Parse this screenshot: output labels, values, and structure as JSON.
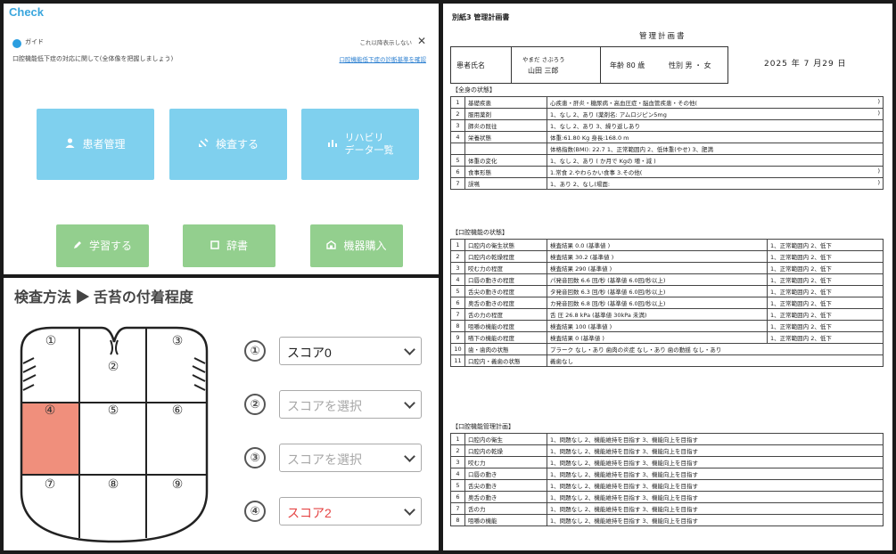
{
  "top_panel": {
    "title": "Check",
    "guide": {
      "label": "ガイド",
      "hide_text": "これ以降表示しない",
      "close_symbol": "✕",
      "text": "口腔機能低下症の対応に関して(全体像を把握しましょう)",
      "link": "口腔機能低下症の診断基準を確認"
    },
    "buttons": [
      {
        "label": "患者管理",
        "icon": "person-icon",
        "glyph": "👤"
      },
      {
        "label": "検査する",
        "icon": "clipboard-icon",
        "glyph": "✎"
      },
      {
        "label": "リハビリ\nデータ一覧",
        "icon": "chart-icon",
        "glyph": "▥"
      },
      {
        "label": "学習する",
        "icon": "pencil-icon",
        "glyph": "✎"
      },
      {
        "label": "辞書",
        "icon": "book-icon",
        "glyph": "▢"
      },
      {
        "label": "機器購入",
        "icon": "cart-icon",
        "glyph": "⌂"
      }
    ]
  },
  "exam_panel": {
    "title": "検査方法 ▶ 舌苔の付着程度",
    "tongue_regions": [
      "①",
      "②",
      "③",
      "④",
      "⑤",
      "⑥",
      "⑦",
      "⑧",
      "⑨"
    ],
    "scores": [
      {
        "num": "①",
        "value": "スコア0",
        "state": "selected"
      },
      {
        "num": "②",
        "value": "スコアを選択",
        "state": "placeholder"
      },
      {
        "num": "③",
        "value": "スコアを選択",
        "state": "placeholder"
      },
      {
        "num": "④",
        "value": "スコア2",
        "state": "highlight"
      }
    ],
    "highlight_color": "#f08f7c"
  },
  "document": {
    "label": "別紙3 管理計画書",
    "title": "管理計画書",
    "patient": {
      "name_label": "患者氏名",
      "kana": "やまだ さぶろう",
      "name": "山田 三郎",
      "age": "年齢 80 歳",
      "sex": "性別 男 ・ 女"
    },
    "date": "2025 年 7 月29 日",
    "sections": [
      {
        "heading": "【全身の状態】",
        "rows": [
          {
            "n": "1",
            "item": "基礎疾患",
            "content": "心疾患・肝炎・糖尿病・高血圧症・脳血管疾患・その他(",
            "right": ")"
          },
          {
            "n": "2",
            "item": "服用薬剤",
            "content": "1、なし 2、あり (薬剤名: アムロジピン5mg",
            "right": ")"
          },
          {
            "n": "3",
            "item": "肺炎の既往",
            "content": "1、なし 2、あり 3、繰り返しあり",
            "right": ""
          },
          {
            "n": "4",
            "item": "栄養状態",
            "content": "体重:61.80 Kg 身長:168.0 m",
            "right": ""
          },
          {
            "n": "",
            "item": "",
            "content": "体格指数(BMI): 22.7 1、正常範囲内 2、低体重(やせ) 3、肥満",
            "right": ""
          },
          {
            "n": "5",
            "item": "体重の変化",
            "content": "1、なし 2、あり ( か月で Kgの 増・減 )",
            "right": ""
          },
          {
            "n": "6",
            "item": "食事形態",
            "content": "1.常食 2.やわらかい食事 3.その他(",
            "right": ")"
          },
          {
            "n": "7",
            "item": "誤嚥",
            "content": "1、あり 2、なし(場面:",
            "right": ")"
          }
        ]
      },
      {
        "heading": "【口腔機能の状態】",
        "rows": [
          {
            "n": "1",
            "item": "口腔内の衛生状態",
            "res": "検査結果 0.0 (基準値 )",
            "right": "1、正常範囲内 2、低下"
          },
          {
            "n": "2",
            "item": "口腔内の乾燥程度",
            "res": "検査結果 30.2 (基準値 )",
            "right": "1、正常範囲内 2、低下"
          },
          {
            "n": "3",
            "item": "咬む力の程度",
            "res": "検査結果 290 (基準値 )",
            "right": "1、正常範囲内 2、低下"
          },
          {
            "n": "4",
            "item": "口唇の動きの程度",
            "res": "パ発音回数 6.6 回/秒 (基準値 6.0回/秒以上)",
            "right": "1、正常範囲内 2、低下"
          },
          {
            "n": "5",
            "item": "舌尖の動きの程度",
            "res": "タ発音回数 6.3 回/秒 (基準値 6.0回/秒以上)",
            "right": "1、正常範囲内 2、低下"
          },
          {
            "n": "6",
            "item": "奥舌の動きの程度",
            "res": "カ発音回数 6.8 回/秒 (基準値 6.0回/秒以上)",
            "right": "1、正常範囲内 2、低下"
          },
          {
            "n": "7",
            "item": "舌の力の程度",
            "res": "舌 圧 26.8 kPa (基準値 30kPa 未満)",
            "right": "1、正常範囲内 2、低下"
          },
          {
            "n": "8",
            "item": "咀嚼の機能の程度",
            "res": "検査結果 100 (基準値 )",
            "right": "1、正常範囲内 2、低下"
          },
          {
            "n": "9",
            "item": "嚥下の機能の程度",
            "res": "検査結果 0 (基準値 )",
            "right": "1、正常範囲内 2、低下"
          },
          {
            "n": "10",
            "item": "歯・歯肉の状態",
            "res": "プラーク なし・あり 歯肉の炎症 なし・あり 歯の動揺 なし・あり",
            "right": ""
          },
          {
            "n": "11",
            "item": "口腔内・義歯の状態",
            "res": "義歯なし",
            "right": ""
          }
        ]
      },
      {
        "heading": "【口腔機能管理計画】",
        "rows": [
          {
            "n": "1",
            "item": "口腔内の衛生",
            "content": "1、問題なし 2、機能維持を目指す 3、機能向上を目指す",
            "right": ""
          },
          {
            "n": "2",
            "item": "口腔内の乾燥",
            "content": "1、問題なし 2、機能維持を目指す 3、機能向上を目指す",
            "right": ""
          },
          {
            "n": "3",
            "item": "咬む力",
            "content": "1、問題なし 2、機能維持を目指す 3、機能向上を目指す",
            "right": ""
          },
          {
            "n": "4",
            "item": "口唇の動き",
            "content": "1、問題なし 2、機能維持を目指す 3、機能向上を目指す",
            "right": ""
          },
          {
            "n": "5",
            "item": "舌尖の動き",
            "content": "1、問題なし 2、機能維持を目指す 3、機能向上を目指す",
            "right": ""
          },
          {
            "n": "6",
            "item": "奥舌の動き",
            "content": "1、問題なし 2、機能維持を目指す 3、機能向上を目指す",
            "right": ""
          },
          {
            "n": "7",
            "item": "舌の力",
            "content": "1、問題なし 2、機能維持を目指す 3、機能向上を目指す",
            "right": ""
          },
          {
            "n": "8",
            "item": "咀嚼の機能",
            "content": "1、問題なし 2、機能維持を目指す 3、機能向上を目指す",
            "right": ""
          }
        ]
      }
    ]
  }
}
